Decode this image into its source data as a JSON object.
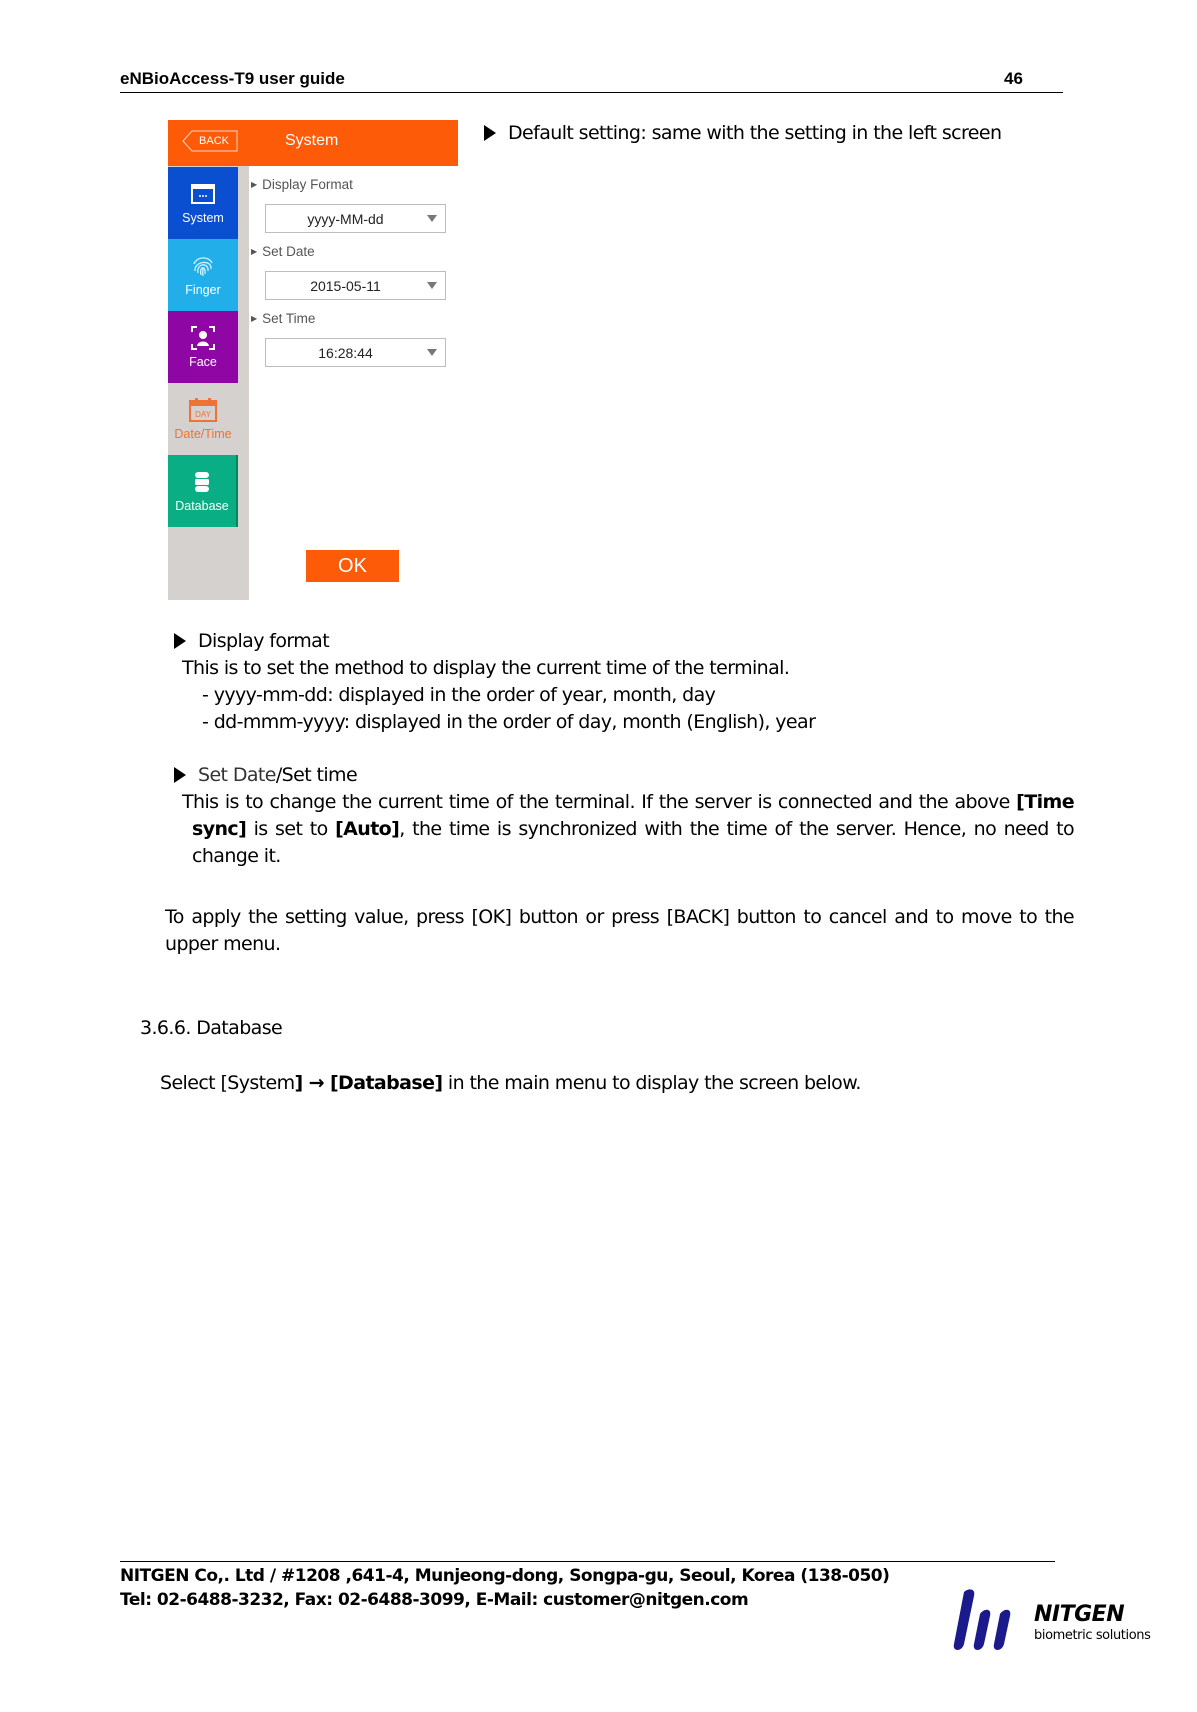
{
  "header": {
    "title": "eNBioAccess-T9 user guide",
    "page_number": "46"
  },
  "device_screen": {
    "back_label": "BACK",
    "title": "System",
    "sidebar": [
      {
        "label": "System",
        "icon": "window-icon",
        "color": "#0a4fcf"
      },
      {
        "label": "Finger",
        "icon": "fingerprint-icon",
        "color": "#21aee9"
      },
      {
        "label": "Face",
        "icon": "face-scan-icon",
        "color": "#8e07a4"
      },
      {
        "label": "Date/Time",
        "icon": "calendar-day-icon",
        "color": "#f07234",
        "active": true
      },
      {
        "label": "Database",
        "icon": "database-icon",
        "color": "#0aae84"
      }
    ],
    "calendar_icon_text": "DAY",
    "fields": [
      {
        "label": "Display Format",
        "value": "yyyy-MM-dd"
      },
      {
        "label": "Set Date",
        "value": "2015-05-11"
      },
      {
        "label": "Set Time",
        "value": "16:28:44"
      }
    ],
    "ok_label": "OK",
    "accent_color": "#fe5b08"
  },
  "content": {
    "default_setting": "Default setting: same with the setting in the left screen",
    "display_format": {
      "heading": "Display format",
      "description": "This is to set the method to display the current time of the terminal.",
      "items": [
        "- yyyy-mm-dd: displayed in the order of year, month, day",
        "- dd-mmm-yyyy: displayed in the order of day, month (English), year"
      ]
    },
    "set_date_time": {
      "heading_a": "Set Date",
      "heading_sep": "/",
      "heading_b": "Set time",
      "text_1": "This is to change the current time of the terminal. If the server is connected and the above ",
      "bold_1": "[Time sync]",
      "text_2": " is set to ",
      "bold_2": "[Auto]",
      "text_3": ", the time is synchronized with the time of the server. Hence, no need to change it."
    },
    "apply_note": "To apply the setting value, press [OK] button or press [BACK] button to cancel and to move to the upper menu.",
    "section": {
      "heading": "3.6.6. Database",
      "text_1": "Select [System",
      "bold_1": "] → [Database]",
      "text_2": " in the main menu to display the screen below."
    }
  },
  "footer": {
    "address": "NITGEN Co,. Ltd / #1208 ,641-4, Munjeong-dong, Songpa-gu, Seoul, Korea (138-050)",
    "contact": "Tel: 02-6488-3232, Fax: 02-6488-3099, E-Mail: customer@nitgen.com",
    "logo_name": "NITGEN",
    "logo_tagline": "biometric solutions",
    "logo_color": "#1a1a8c"
  }
}
